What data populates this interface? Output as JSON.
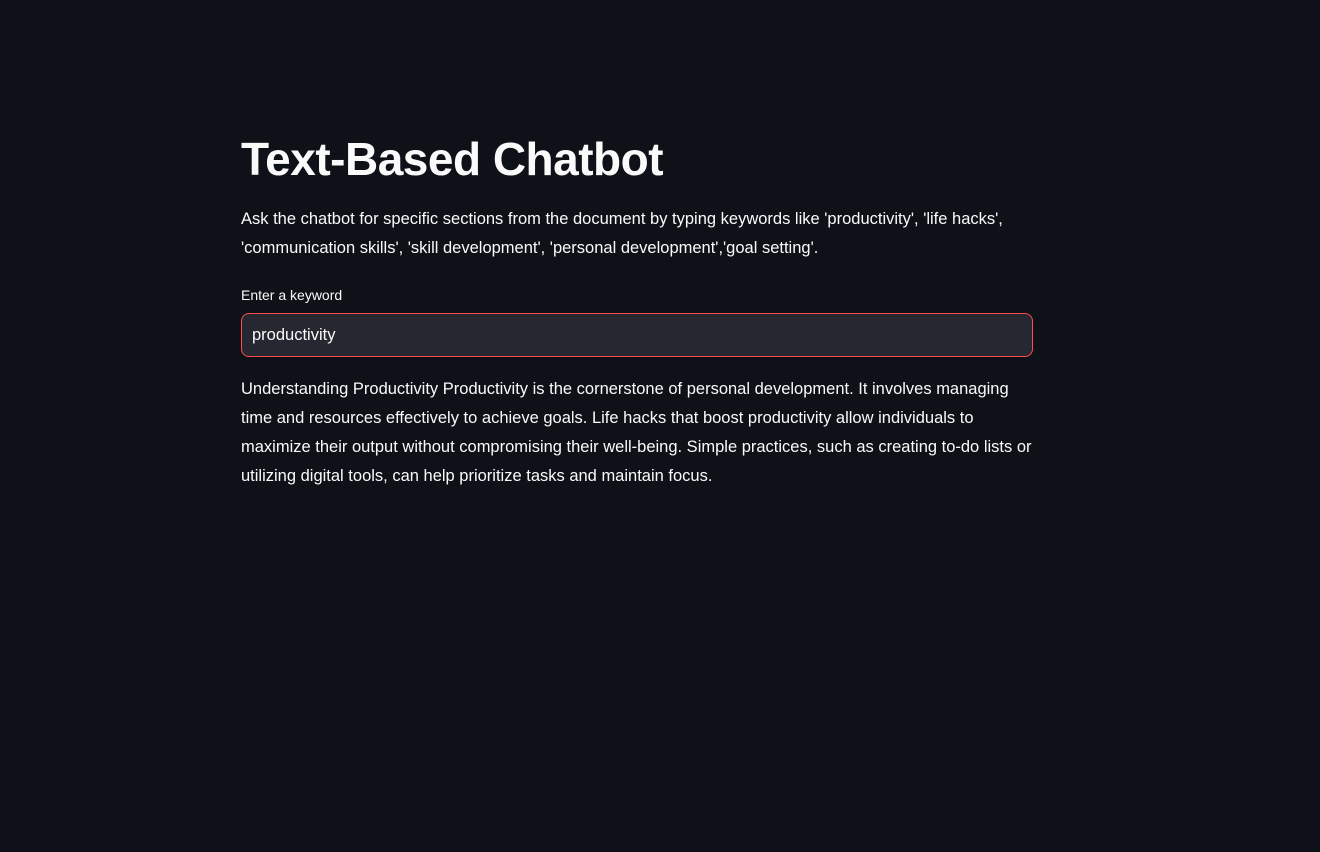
{
  "app": {
    "title": "Text-Based Chatbot",
    "intro": "Ask the chatbot for specific sections from the document by typing keywords like 'productivity', 'life hacks', 'communication skills', 'skill development', 'personal development','goal setting'."
  },
  "keyword_input": {
    "label": "Enter a keyword",
    "value": "productivity",
    "placeholder": ""
  },
  "response": {
    "text": "Understanding Productivity Productivity is the cornerstone of personal development. It involves managing time and resources effectively to achieve goals. Life hacks that boost productivity allow individuals to maximize their output without compromising their well-being. Simple practices, such as creating to-do lists or utilizing digital tools, can help prioritize tasks and maintain focus."
  },
  "colors": {
    "background": "#0e1117",
    "text": "#fafafa",
    "input_background": "#262730",
    "input_focus_border": "#ff4b4b"
  }
}
